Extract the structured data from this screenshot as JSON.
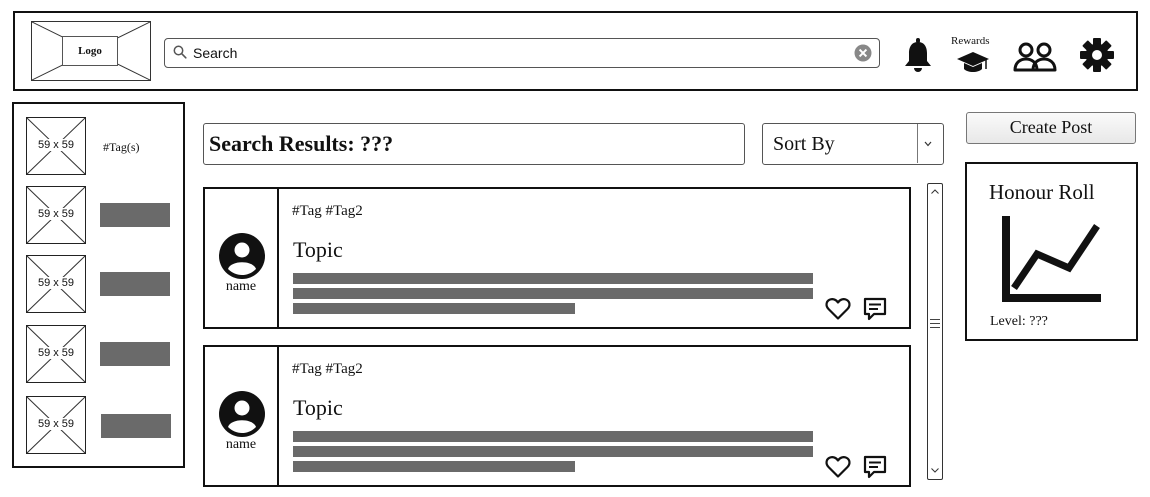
{
  "header": {
    "logo": "Logo",
    "search": {
      "value": "",
      "placeholder": "Search"
    },
    "rewards_label": "Rewards"
  },
  "sidebar": {
    "items": [
      {
        "thumb": "59 x 59",
        "tag": "#Tag(s)"
      },
      {
        "thumb": "59 x 59",
        "tag": ""
      },
      {
        "thumb": "59 x 59",
        "tag": ""
      },
      {
        "thumb": "59 x 59",
        "tag": ""
      },
      {
        "thumb": "59 x 59",
        "tag": ""
      }
    ]
  },
  "results": {
    "title": "Search Results: ???",
    "sort_label": "Sort By"
  },
  "posts": [
    {
      "author": "name",
      "tags": "#Tag #Tag2",
      "topic": "Topic"
    },
    {
      "author": "name",
      "tags": "#Tag #Tag2",
      "topic": "Topic"
    }
  ],
  "right": {
    "create_post_label": "Create Post",
    "honour_roll": {
      "title": "Honour Roll",
      "level": "Level: ???"
    }
  },
  "icons": {
    "search": "search-icon",
    "clear": "clear-icon",
    "notifications": "bell-icon",
    "rewards": "graduation-cap-icon",
    "friends": "users-icon",
    "settings": "gear-icon",
    "avatar": "user-avatar-icon",
    "like": "heart-icon",
    "comment": "comment-icon",
    "chart": "line-chart-icon"
  }
}
